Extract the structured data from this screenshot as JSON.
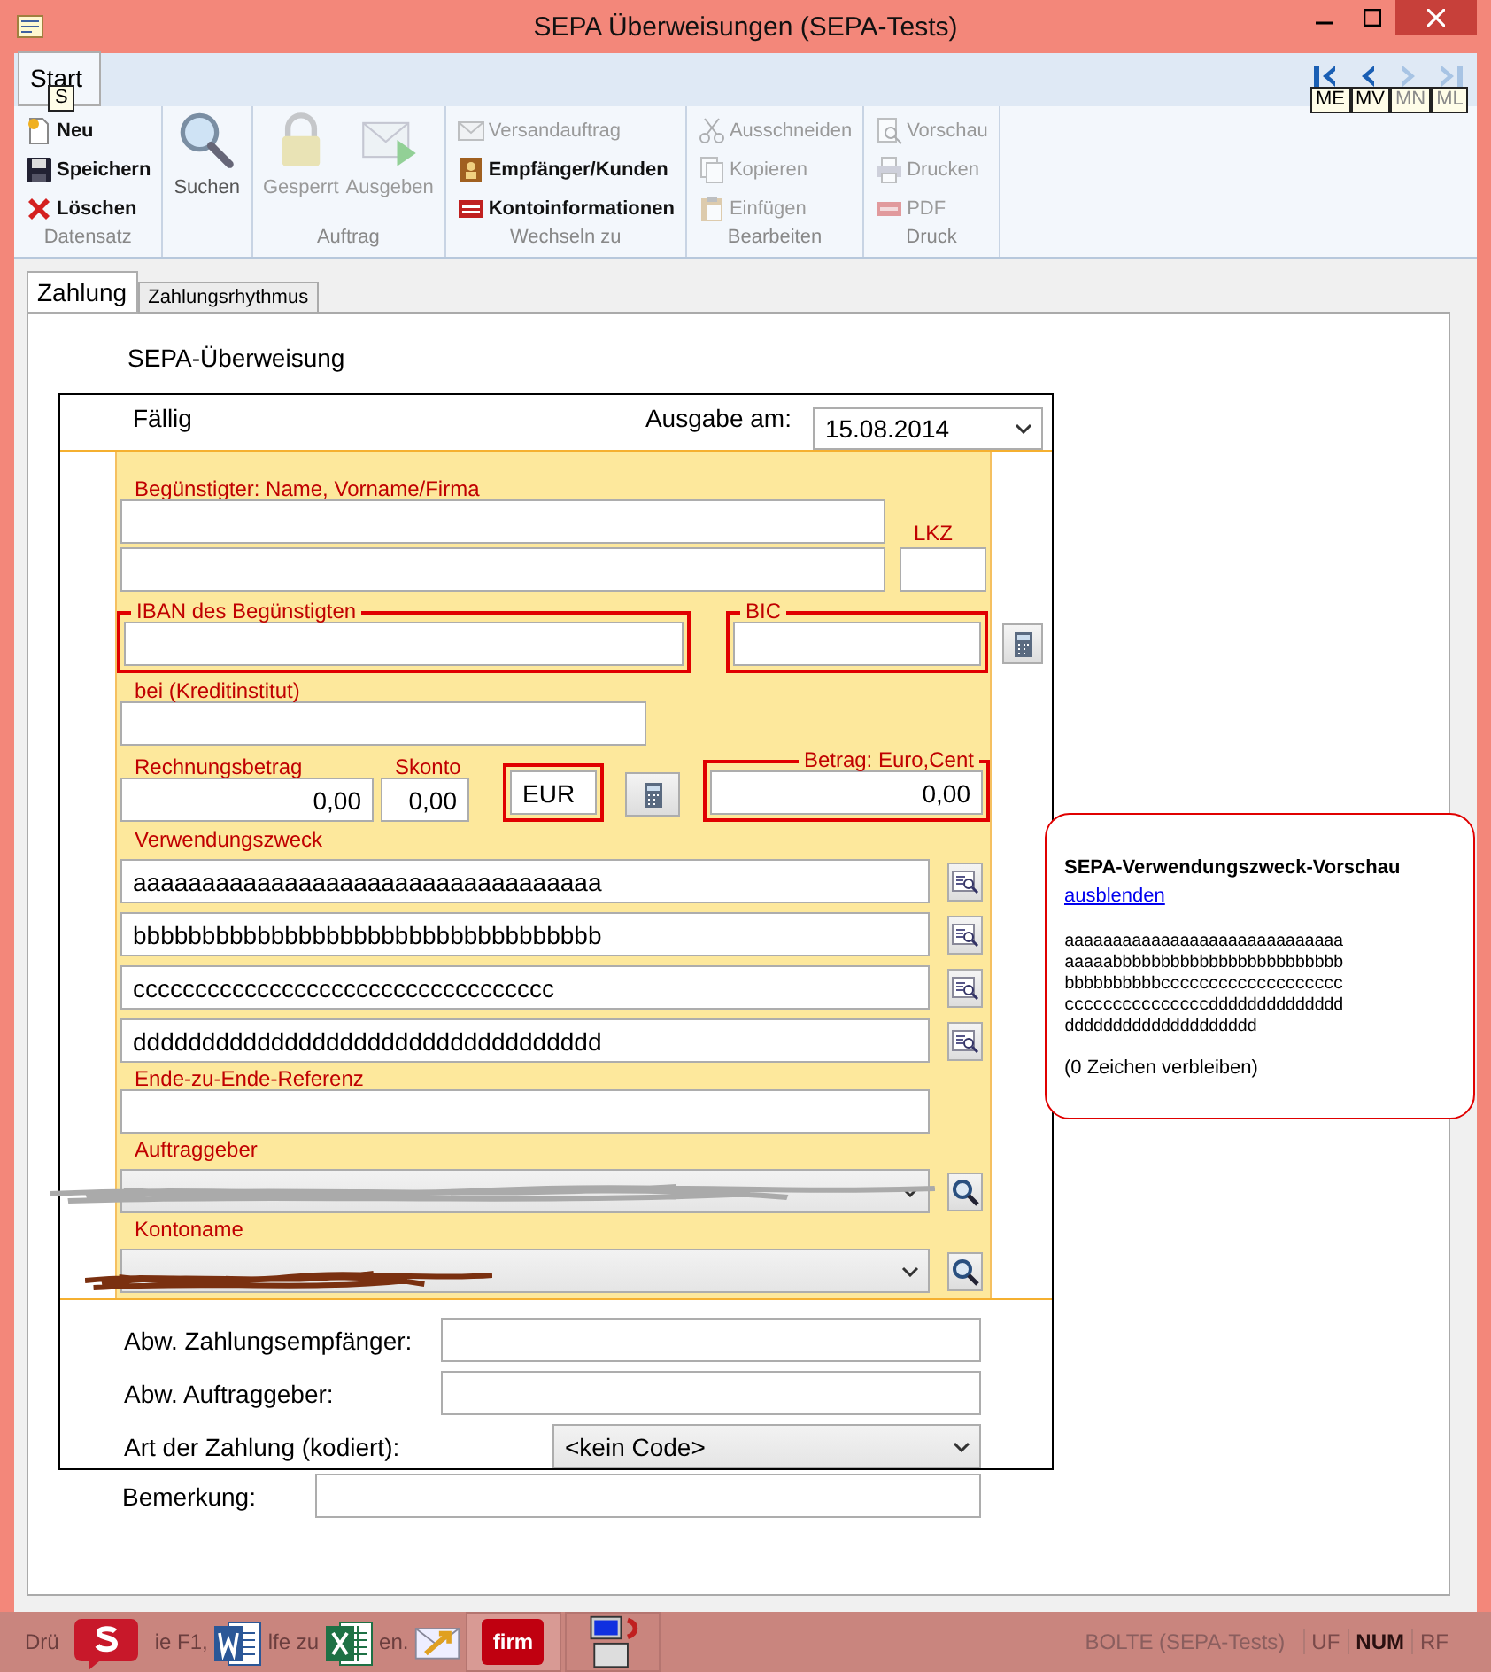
{
  "window": {
    "title": "SEPA Überweisungen (SEPA-Tests)"
  },
  "ribbon": {
    "tabs": [
      {
        "label": "Start",
        "selected": true,
        "keytip": "S"
      }
    ],
    "nav": [
      {
        "kind": "first",
        "keytip": "ME",
        "disabled": false
      },
      {
        "kind": "prev",
        "keytip": "MV",
        "disabled": false
      },
      {
        "kind": "next",
        "keytip": "MN",
        "disabled": true
      },
      {
        "kind": "last",
        "keytip": "ML",
        "disabled": true
      }
    ],
    "groups": [
      {
        "label": "Datensatz",
        "kind": "small",
        "items": [
          {
            "label": "Neu",
            "kind": "new",
            "disabled": false
          },
          {
            "label": "Speichern",
            "kind": "save",
            "disabled": false
          },
          {
            "label": "Löschen",
            "kind": "delete",
            "disabled": false
          }
        ]
      },
      {
        "kind": "large",
        "items": [
          {
            "label": "Suchen",
            "kind": "search",
            "disabled": false
          }
        ]
      },
      {
        "label": "Auftrag",
        "kind": "large",
        "items": [
          {
            "label": "Gesperrt",
            "kind": "lock",
            "disabled": true
          },
          {
            "label": "Ausgeben",
            "kind": "send",
            "disabled": true
          }
        ]
      },
      {
        "label": "Wechseln zu",
        "kind": "small",
        "items": [
          {
            "label": "Versandauftrag",
            "kind": "mail",
            "disabled": true
          },
          {
            "label": "Empfänger/Kunden",
            "kind": "contacts",
            "disabled": false
          },
          {
            "label": "Kontoinformationen",
            "kind": "account",
            "disabled": false
          }
        ]
      },
      {
        "label": "Bearbeiten",
        "kind": "small",
        "items": [
          {
            "label": "Ausschneiden",
            "kind": "cut",
            "disabled": true
          },
          {
            "label": "Kopieren",
            "kind": "copy",
            "disabled": true
          },
          {
            "label": "Einfügen",
            "kind": "paste",
            "disabled": true
          }
        ]
      },
      {
        "label": "Druck",
        "kind": "small",
        "items": [
          {
            "label": "Vorschau",
            "kind": "preview",
            "disabled": true
          },
          {
            "label": "Drucken",
            "kind": "print",
            "disabled": true
          },
          {
            "label": "PDF",
            "kind": "pdf",
            "disabled": true
          }
        ]
      }
    ]
  },
  "form": {
    "tabs": [
      {
        "label": "Zahlung",
        "selected": true
      },
      {
        "label": "Zahlungsrhythmus",
        "selected": false
      }
    ],
    "heading": "SEPA-Überweisung",
    "due_label": "Fällig",
    "issue_label": "Ausgabe am:",
    "issue_date": "15.08.2014",
    "beneficiary_label": "Begünstigter: Name, Vorname/Firma",
    "country_label": "LKZ",
    "iban_label": "IBAN des Begünstigten",
    "bic_label": "BIC",
    "bank_label": "bei (Kreditinstitut)",
    "invoice": {
      "label": "Rechnungsbetrag",
      "value": "0,00"
    },
    "discount": {
      "label": "Skonto",
      "value": "0,00"
    },
    "currency": "EUR",
    "amount": {
      "label": "Betrag: Euro,Cent",
      "value": "0,00"
    },
    "purpose": {
      "label": "Verwendungszweck",
      "lines": [
        "aaaaaaaaaaaaaaaaaaaaaaaaaaaaaaaaaa",
        "bbbbbbbbbbbbbbbbbbbbbbbbbbbbbbbbbb",
        "cccccccccccccccccccccccccccccccccc",
        "dddddddddddddddddddddddddddddddddd"
      ]
    },
    "e2e_label": "Ende-zu-Ende-Referenz",
    "principal": {
      "label": "Auftraggeber",
      "redacted": true
    },
    "account_name": {
      "label": "Kontoname",
      "redacted": true
    },
    "alt_payee_label": "Abw. Zahlungsempfänger:",
    "alt_principal_label": "Abw. Auftraggeber:",
    "payment_type": {
      "label": "Art der Zahlung (kodiert):",
      "value": "<kein Code>"
    },
    "remark_label": "Bemerkung:"
  },
  "preview": {
    "title": "SEPA-Verwendungszweck-Vorschau",
    "link": "ausblenden",
    "lines": [
      "aaaaaaaaaaaaaaaaaaaaaaaaaaaaa",
      "aaaaabbbbbbbbbbbbbbbbbbbbbbbb",
      "bbbbbbbbbbccccccccccccccccccc",
      "cccccccccccccccdddddddddddddd",
      "dddddddddddddddddddd"
    ],
    "remaining": "(0 Zeichen verbleiben)"
  },
  "status_bar": {
    "text_fragments": [
      "Drü",
      "ie F1,",
      "lfe zu",
      "en."
    ],
    "user": "BOLTE (SEPA-Tests)",
    "indicators": [
      {
        "label": "UF",
        "on": false
      },
      {
        "label": "NUM",
        "on": true
      },
      {
        "label": "RF",
        "on": false
      }
    ]
  },
  "taskbar": [
    {
      "kind": "s-app",
      "selected": false
    },
    {
      "kind": "word",
      "selected": false
    },
    {
      "kind": "excel",
      "selected": false
    },
    {
      "kind": "mail",
      "selected": false
    },
    {
      "kind": "firm",
      "label": "firm",
      "selected": true
    },
    {
      "kind": "computer",
      "selected": false
    }
  ]
}
